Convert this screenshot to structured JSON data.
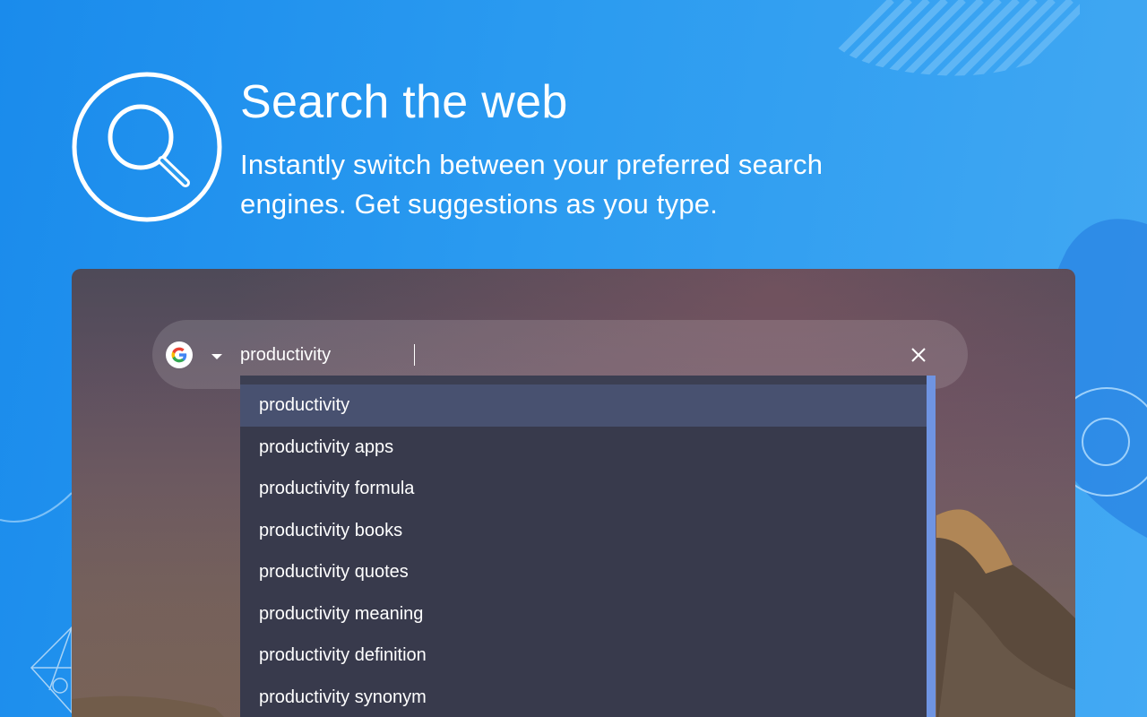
{
  "hero": {
    "icon": "search-icon",
    "title": "Search the web",
    "subtitle": "Instantly switch between your preferred search engines. Get suggestions as you type."
  },
  "search": {
    "engine_icon": "google-g-icon",
    "engine_caret_icon": "caret-down-icon",
    "query": "productivity",
    "clear_icon": "close-icon"
  },
  "suggestions": [
    {
      "label": "productivity",
      "active": true
    },
    {
      "label": "productivity apps",
      "active": false
    },
    {
      "label": "productivity formula",
      "active": false
    },
    {
      "label": "productivity books",
      "active": false
    },
    {
      "label": "productivity quotes",
      "active": false
    },
    {
      "label": "productivity meaning",
      "active": false
    },
    {
      "label": "productivity definition",
      "active": false
    },
    {
      "label": "productivity synonym",
      "active": false
    }
  ],
  "colors": {
    "background": "#2b9bf0",
    "dropdown": "#383a4c",
    "dropdown_active": "#485170",
    "scrollbar": "#6f94e2"
  }
}
